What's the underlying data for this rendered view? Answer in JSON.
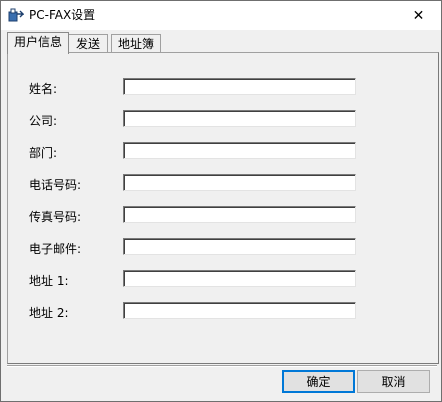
{
  "window": {
    "title": "PC-FAX设置",
    "close_symbol": "✕"
  },
  "tabs": [
    {
      "label": "用户信息",
      "active": true
    },
    {
      "label": "发送",
      "active": false
    },
    {
      "label": "地址簿",
      "active": false
    }
  ],
  "form": {
    "fields": [
      {
        "label": "姓名:",
        "value": ""
      },
      {
        "label": "公司:",
        "value": ""
      },
      {
        "label": "部门:",
        "value": ""
      },
      {
        "label": "电话号码:",
        "value": ""
      },
      {
        "label": "传真号码:",
        "value": ""
      },
      {
        "label": "电子邮件:",
        "value": ""
      },
      {
        "label": "地址 1:",
        "value": ""
      },
      {
        "label": "地址 2:",
        "value": ""
      }
    ]
  },
  "buttons": {
    "ok": "确定",
    "cancel": "取消"
  },
  "icons": {
    "app": "fax-app-icon",
    "close": "close-icon"
  }
}
